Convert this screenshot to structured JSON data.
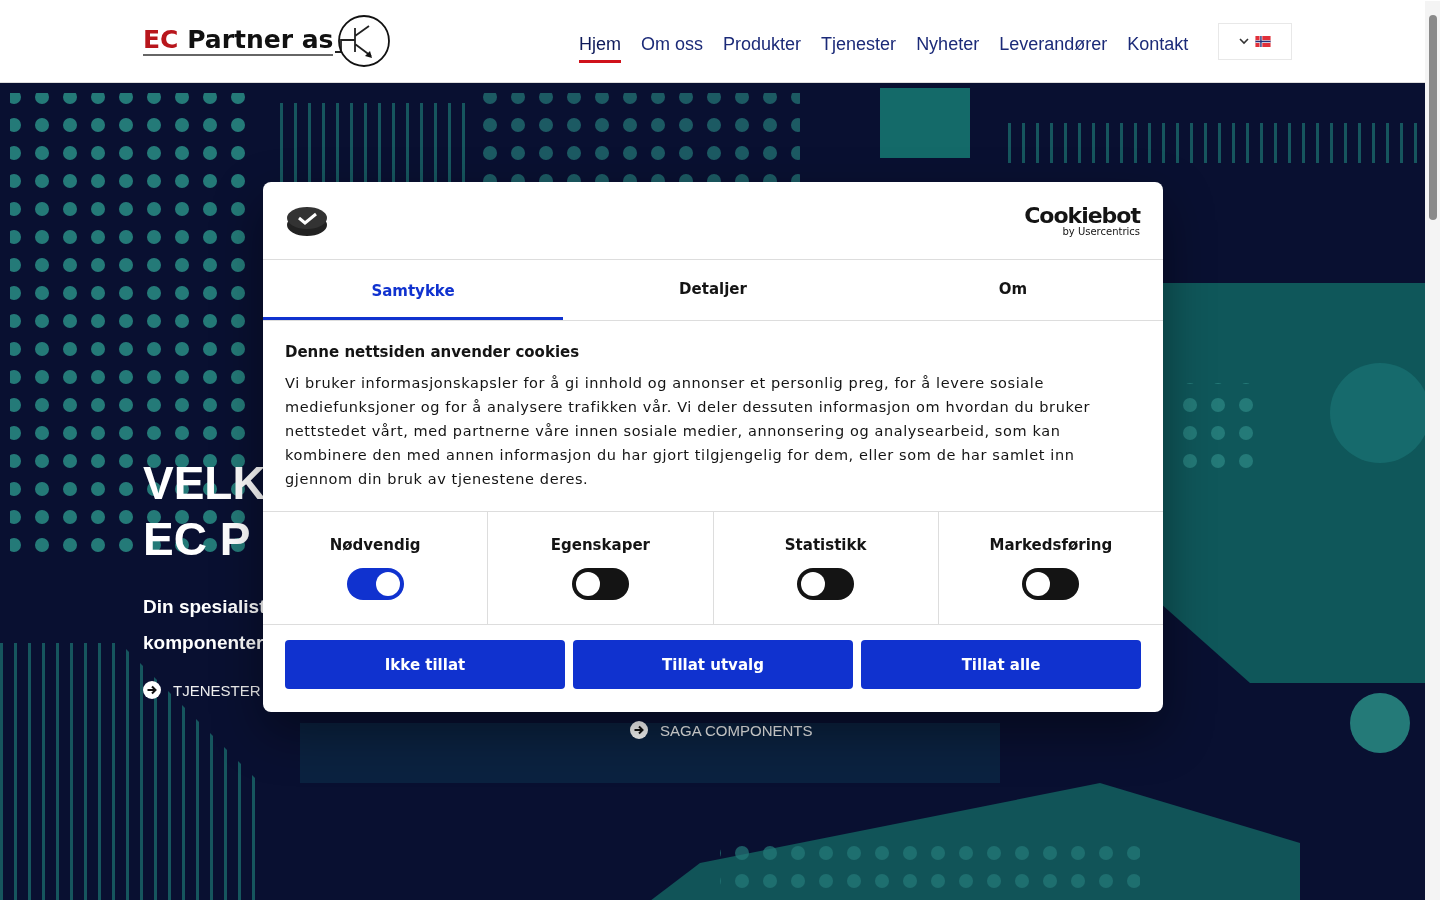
{
  "header": {
    "logo": {
      "part_1": "EC",
      "part_2": "Partner as"
    },
    "nav": [
      {
        "label": "Hjem",
        "selected": true
      },
      {
        "label": "Om oss",
        "selected": false
      },
      {
        "label": "Produkter",
        "selected": false
      },
      {
        "label": "Tjenester",
        "selected": false
      },
      {
        "label": "Nyheter",
        "selected": false
      },
      {
        "label": "Leverandører",
        "selected": false
      },
      {
        "label": "Kontakt",
        "selected": false
      }
    ]
  },
  "hero": {
    "heading_lines": [
      "VELK",
      "EC P"
    ],
    "subtitle_lines": [
      "Din spesialist",
      "komponenter"
    ],
    "links": [
      "TJENESTER",
      "SAGA COMPONENTS"
    ]
  },
  "cookie_dialog": {
    "brand": {
      "name": "Cookiebot",
      "byline": "by Usercentrics"
    },
    "tabs": [
      {
        "label": "Samtykke",
        "selected": true
      },
      {
        "label": "Detaljer",
        "selected": false
      },
      {
        "label": "Om",
        "selected": false
      }
    ],
    "title": "Denne nettsiden anvender cookies",
    "text": "Vi bruker informasjonskapsler for å gi innhold og annonser et personlig preg, for å levere sosiale mediefunksjoner og for å analysere trafikken vår. Vi deler dessuten informasjon om hvordan du bruker nettstedet vårt, med partnerne våre innen sosiale medier, annonsering og analysearbeid, som kan kombinere den med annen informasjon du har gjort tilgjengelig for dem, eller som de har samlet inn gjennom din bruk av tjenestene deres.",
    "categories": [
      {
        "label": "Nødvendig",
        "on": true
      },
      {
        "label": "Egenskaper",
        "on": false
      },
      {
        "label": "Statistikk",
        "on": false
      },
      {
        "label": "Markedsføring",
        "on": false
      }
    ],
    "buttons": [
      "Ikke tillat",
      "Tillat utvalg",
      "Tillat alle"
    ]
  }
}
